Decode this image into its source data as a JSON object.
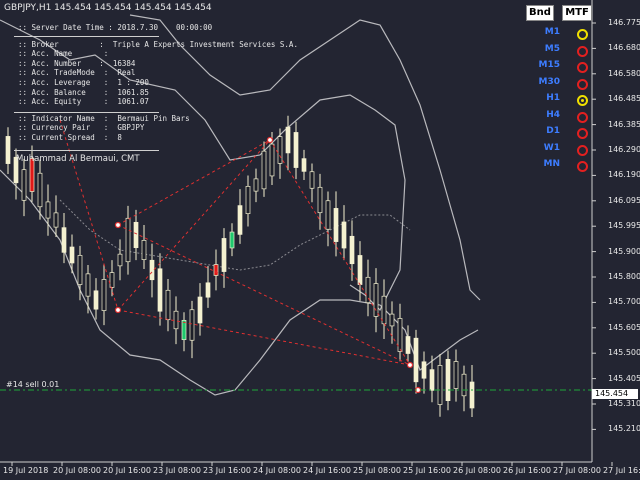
{
  "symbol_line": "GBPJPY,H1  145.454 145.454 145.454 145.454",
  "info": {
    "server_time": ":: Server Date Time : 2018.7.30    00:00:00",
    "broker": ":: Broker         :  Triple A Experts Investment Services S.A.",
    "acc_name": ":: Acc. Name       :",
    "acc_number": ":: Acc. Number    :  16384",
    "acc_trademode": ":: Acc. TradeMode  :  Real",
    "acc_leverage": ":: Acc. Leverage   :  1 : 200",
    "acc_balance": ":: Acc. Balance    :  1061.85",
    "acc_equity": ":: Acc. Equity     :  1061.07",
    "indicator_name": ":: Indicator Name  :  Bermaui Pin Bars",
    "currency_pair": ":: Currency Pair   :  GBPJPY",
    "current_spread": ":: Current Spread  :  8",
    "author": "Muhammad Al Bermaui, CMT"
  },
  "buttons": {
    "bnd": "Bnd",
    "mtf": "MTF"
  },
  "timeframes": [
    {
      "label": "M1",
      "status": "yellow"
    },
    {
      "label": "M5",
      "status": "red"
    },
    {
      "label": "M15",
      "status": "red"
    },
    {
      "label": "M30",
      "status": "red"
    },
    {
      "label": "H1",
      "status": "yellow-dot"
    },
    {
      "label": "H4",
      "status": "red"
    },
    {
      "label": "D1",
      "status": "red"
    },
    {
      "label": "W1",
      "status": "red"
    },
    {
      "label": "MN",
      "status": "red"
    }
  ],
  "price_axis": [
    "146.775",
    "146.680",
    "146.580",
    "146.485",
    "146.385",
    "146.290",
    "146.190",
    "146.095",
    "145.995",
    "145.900",
    "145.800",
    "145.700",
    "145.605",
    "145.500",
    "145.405",
    "145.310",
    "145.210"
  ],
  "current_price": "145.454",
  "time_axis": [
    "19 Jul 2018",
    "20 Jul 08:00",
    "20 Jul 16:00",
    "23 Jul 08:00",
    "23 Jul 16:00",
    "24 Jul 08:00",
    "24 Jul 16:00",
    "25 Jul 08:00",
    "25 Jul 16:00",
    "26 Jul 08:00",
    "26 Jul 16:00",
    "27 Jul 08:00",
    "27 Jul 16:00"
  ],
  "order_label": "#14 sell 0.01",
  "colors": {
    "background": "#232532",
    "bull_candle": "#f4f1d0",
    "bear_candle": "#1c1e28",
    "pin_bull": "#1ec86e",
    "pin_bear": "#e01818",
    "band": "#b9b9bd",
    "trend": "#e03030",
    "order_line": "#1fa83a"
  }
}
